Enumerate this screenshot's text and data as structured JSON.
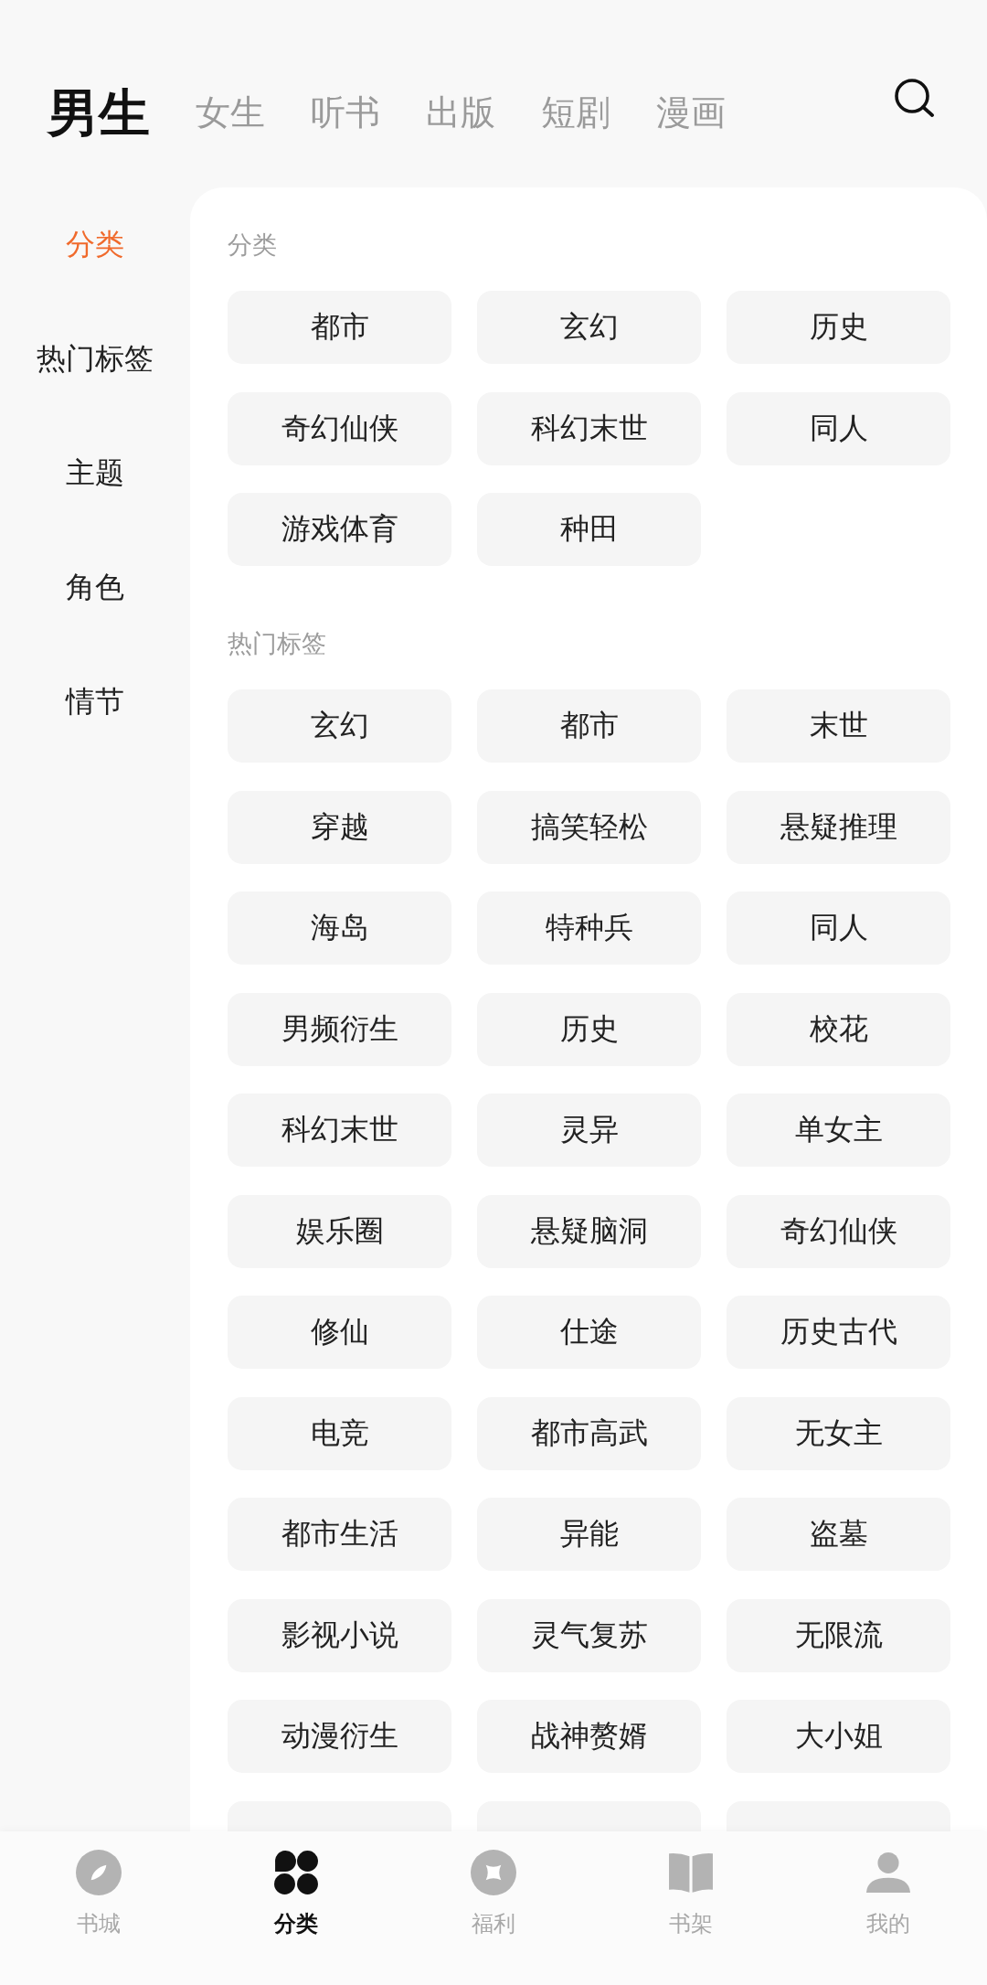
{
  "top_tabs": [
    {
      "label": "男生",
      "selected": true
    },
    {
      "label": "女生",
      "selected": false
    },
    {
      "label": "听书",
      "selected": false
    },
    {
      "label": "出版",
      "selected": false
    },
    {
      "label": "短剧",
      "selected": false
    },
    {
      "label": "漫画",
      "selected": false
    }
  ],
  "sidebar": {
    "items": [
      {
        "label": "分类",
        "selected": true
      },
      {
        "label": "热门标签",
        "selected": false
      },
      {
        "label": "主题",
        "selected": false
      },
      {
        "label": "角色",
        "selected": false
      },
      {
        "label": "情节",
        "selected": false
      }
    ]
  },
  "sections": [
    {
      "title": "分类",
      "tags": [
        {
          "kind": "tag",
          "label": "都市"
        },
        {
          "kind": "tag",
          "label": "玄幻"
        },
        {
          "kind": "tag",
          "label": "历史"
        },
        {
          "kind": "tag",
          "label": "奇幻仙侠"
        },
        {
          "kind": "tag",
          "label": "科幻末世"
        },
        {
          "kind": "tag",
          "label": "同人"
        },
        {
          "kind": "tag",
          "label": "游戏体育"
        },
        {
          "kind": "tag",
          "label": "种田"
        }
      ]
    },
    {
      "title": "热门标签",
      "tags": [
        {
          "kind": "tag",
          "label": "玄幻"
        },
        {
          "kind": "tag",
          "label": "都市"
        },
        {
          "kind": "tag",
          "label": "末世"
        },
        {
          "kind": "tag",
          "label": "穿越"
        },
        {
          "kind": "tag",
          "label": "搞笑轻松"
        },
        {
          "kind": "tag",
          "label": "悬疑推理"
        },
        {
          "kind": "tag",
          "label": "海岛"
        },
        {
          "kind": "tag",
          "label": "特种兵"
        },
        {
          "kind": "tag",
          "label": "同人"
        },
        {
          "kind": "tag",
          "label": "男频衍生"
        },
        {
          "kind": "tag",
          "label": "历史"
        },
        {
          "kind": "tag",
          "label": "校花"
        },
        {
          "kind": "tag",
          "label": "科幻末世"
        },
        {
          "kind": "tag",
          "label": "灵异"
        },
        {
          "kind": "tag",
          "label": "单女主"
        },
        {
          "kind": "tag",
          "label": "娱乐圈"
        },
        {
          "kind": "tag",
          "label": "悬疑脑洞"
        },
        {
          "kind": "tag",
          "label": "奇幻仙侠"
        },
        {
          "kind": "tag",
          "label": "修仙"
        },
        {
          "kind": "tag",
          "label": "仕途"
        },
        {
          "kind": "tag",
          "label": "历史古代"
        },
        {
          "kind": "tag",
          "label": "电竞"
        },
        {
          "kind": "tag",
          "label": "都市高武"
        },
        {
          "kind": "tag",
          "label": "无女主"
        },
        {
          "kind": "tag",
          "label": "都市生活"
        },
        {
          "kind": "tag",
          "label": "异能"
        },
        {
          "kind": "tag",
          "label": "盗墓"
        },
        {
          "kind": "tag",
          "label": "影视小说"
        },
        {
          "kind": "tag",
          "label": "灵气复苏"
        },
        {
          "kind": "tag",
          "label": "无限流"
        },
        {
          "kind": "tag",
          "label": "动漫衍生"
        },
        {
          "kind": "tag",
          "label": "战神赘婿"
        },
        {
          "kind": "tag",
          "label": "大小姐"
        },
        {
          "kind": "clipped"
        },
        {
          "kind": "clipped"
        },
        {
          "kind": "clipped"
        }
      ]
    }
  ],
  "bottom_nav": [
    {
      "label": "书城",
      "selected": false
    },
    {
      "label": "分类",
      "selected": true
    },
    {
      "label": "福利",
      "selected": false
    },
    {
      "label": "书架",
      "selected": false
    },
    {
      "label": "我的",
      "selected": false
    }
  ]
}
